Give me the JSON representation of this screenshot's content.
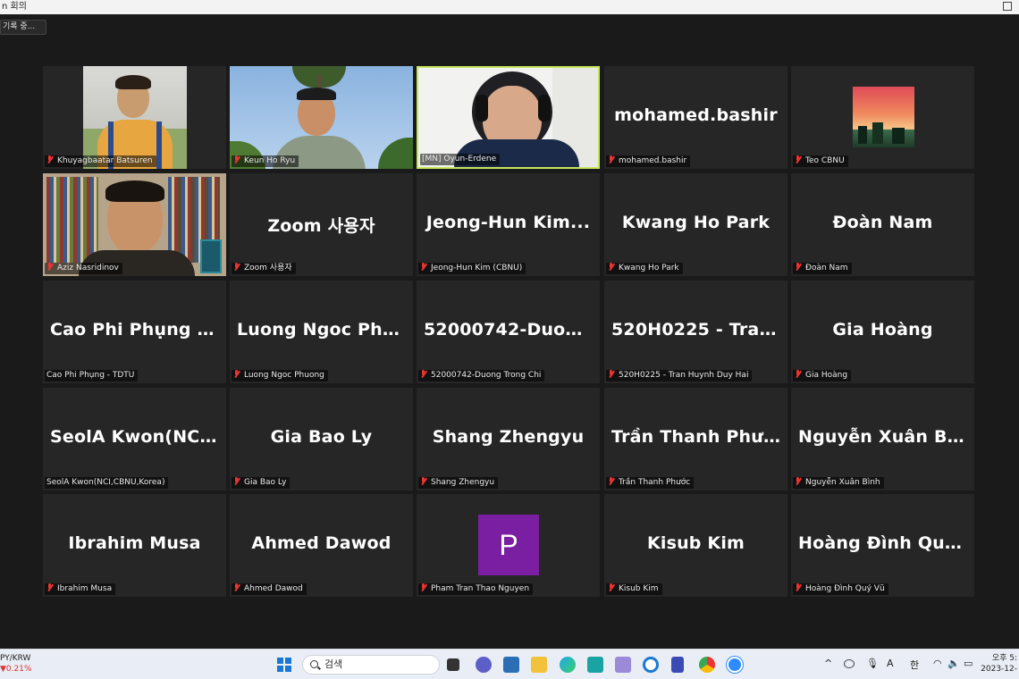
{
  "window": {
    "title": "n 회의"
  },
  "recording": {
    "label": "기록 중..."
  },
  "tiles": [
    {
      "name": "Khuyagbaatar Batsuren",
      "label": "Khuyagbaatar Batsuren",
      "video": true,
      "muted": true
    },
    {
      "name": "Keun Ho Ryu",
      "label": "Keun Ho Ryu",
      "video": true,
      "muted": true
    },
    {
      "name": "[MN] Oyun-Erdene",
      "label": "[MN] Oyun-Erdene",
      "video": true,
      "muted": false,
      "active": true
    },
    {
      "name": "mohamed.bashir",
      "label": "mohamed.bashir",
      "video": false,
      "muted": true
    },
    {
      "name": "Teo CBNU",
      "label": "Teo CBNU",
      "video": false,
      "avatar": "sunset",
      "muted": true
    },
    {
      "name": "Aziz Nasridinov",
      "label": "Aziz Nasridinov",
      "video": true,
      "muted": true
    },
    {
      "name": "Zoom 사용자",
      "label": "Zoom 사용자",
      "video": false,
      "muted": true
    },
    {
      "name": "Jeong-Hun  Kim...",
      "label": "Jeong-Hun Kim (CBNU)",
      "video": false,
      "muted": true
    },
    {
      "name": "Kwang Ho Park",
      "label": "Kwang Ho Park",
      "video": false,
      "muted": true
    },
    {
      "name": "Đoàn Nam",
      "label": "Đoàn Nam",
      "video": false,
      "muted": true
    },
    {
      "name": "Cao Phi Phụng -...",
      "label": "Cao Phi Phụng - TDTU",
      "video": false,
      "muted": false
    },
    {
      "name": "Luong Ngoc Phu...",
      "label": "Luong Ngoc Phuong",
      "video": false,
      "muted": true
    },
    {
      "name": "52000742-Duon...",
      "label": "52000742-Duong Trong Chi",
      "video": false,
      "muted": true
    },
    {
      "name": "520H0225 - Tran...",
      "label": "520H0225 - Tran Huynh Duy Hai",
      "video": false,
      "muted": true
    },
    {
      "name": "Gia Hoàng",
      "label": "Gia Hoàng",
      "video": false,
      "muted": true
    },
    {
      "name": "SeolA  Kwon(NCI...",
      "label": "SeolA Kwon(NCI,CBNU,Korea)",
      "video": false,
      "muted": false
    },
    {
      "name": "Gia Bao Ly",
      "label": "Gia Bao Ly",
      "video": false,
      "muted": true
    },
    {
      "name": "Shang Zhengyu",
      "label": "Shang Zhengyu",
      "video": false,
      "muted": true
    },
    {
      "name": "Trần Thanh Phước",
      "label": "Trần Thanh Phước",
      "video": false,
      "muted": true
    },
    {
      "name": "Nguyễn Xuân Bình",
      "label": "Nguyễn Xuân Bình",
      "video": false,
      "muted": true
    },
    {
      "name": "Ibrahim Musa",
      "label": "Ibrahim Musa",
      "video": false,
      "muted": true
    },
    {
      "name": "Ahmed Dawod",
      "label": "Ahmed Dawod",
      "video": false,
      "muted": true
    },
    {
      "name": "",
      "label": "Pham Tran Thao Nguyen",
      "video": false,
      "avatar_letter": "P",
      "avatar_color": "#7b1fa2",
      "muted": true
    },
    {
      "name": "Kisub Kim",
      "label": "Kisub Kim",
      "video": false,
      "muted": true
    },
    {
      "name": "Hoàng Đình Quý...",
      "label": "Hoàng Đình Quý Vũ",
      "video": false,
      "muted": true
    }
  ],
  "taskbar": {
    "ticker_pair": "PY/KRW",
    "ticker_change": "0.21%",
    "search_placeholder": "검색",
    "tray_lang": "A",
    "tray_ime": "한",
    "clock_line1": "오후 5:",
    "clock_line2": "2023-12-"
  }
}
